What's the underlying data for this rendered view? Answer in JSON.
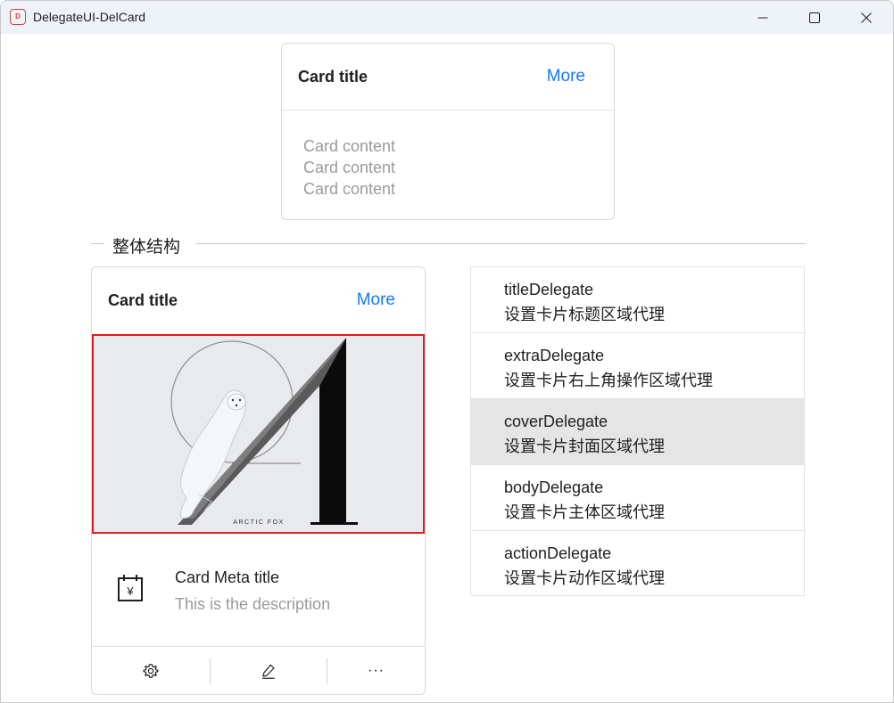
{
  "window": {
    "title": "DelegateUI-DelCard",
    "app_icon_text": "D"
  },
  "top_card": {
    "title": "Card title",
    "extra": "More",
    "content": [
      "Card content",
      "Card content",
      "Card content"
    ]
  },
  "divider": {
    "label": "整体结构"
  },
  "structure_card": {
    "title": "Card title",
    "extra": "More",
    "cover_caption": "ARCTIC FOX",
    "meta_icon": "calendar-yen-icon",
    "meta_icon_glyph": "¥",
    "meta_title": "Card Meta title",
    "meta_description": "This is the description",
    "actions": [
      {
        "icon": "gear-icon"
      },
      {
        "icon": "edit-icon"
      },
      {
        "icon": "ellipsis-icon",
        "glyph": "···"
      }
    ]
  },
  "delegates": [
    {
      "name": "titleDelegate",
      "desc": "设置卡片标题区域代理",
      "active": false
    },
    {
      "name": "extraDelegate",
      "desc": "设置卡片右上角操作区域代理",
      "active": false
    },
    {
      "name": "coverDelegate",
      "desc": "设置卡片封面区域代理",
      "active": true
    },
    {
      "name": "bodyDelegate",
      "desc": "设置卡片主体区域代理",
      "active": false
    },
    {
      "name": "actionDelegate",
      "desc": "设置卡片动作区域代理",
      "active": false
    }
  ],
  "colors": {
    "accent": "#1677ff",
    "highlight_border": "#e11d1d",
    "active_row": "#e5e5e5"
  }
}
